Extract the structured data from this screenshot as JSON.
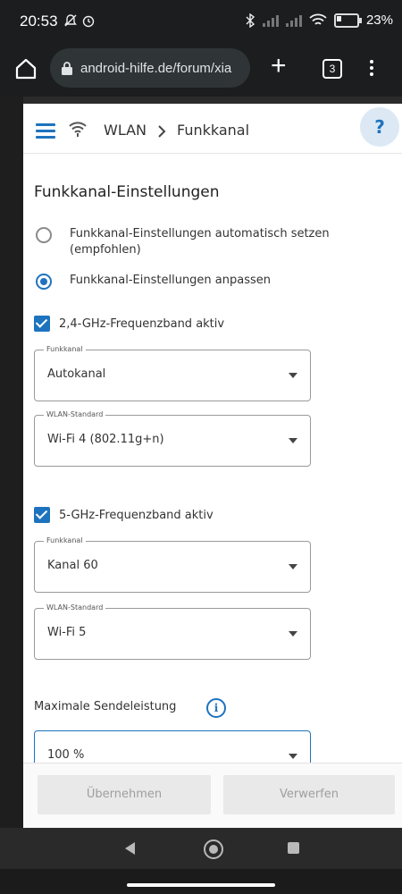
{
  "status": {
    "time": "20:53",
    "battery": "23%"
  },
  "browser": {
    "url": "android-hilfe.de/forum/xia",
    "tab_count": "3"
  },
  "app": {
    "breadcrumb": [
      "WLAN",
      "Funkkanal"
    ],
    "help_label": "?"
  },
  "page": {
    "section_title": "Funkkanal-Einstellungen",
    "radio_auto": "Funkkanal-Einstellungen automatisch setzen (empfohlen)",
    "radio_custom": "Funkkanal-Einstellungen anpassen",
    "band24": {
      "checkbox_label": "2,4-GHz-Frequenzband aktiv",
      "channel_legend": "Funkkanal",
      "channel_value": "Autokanal",
      "standard_legend": "WLAN-Standard",
      "standard_value": "Wi-Fi 4 (802.11g+n)"
    },
    "band5": {
      "checkbox_label": "5-GHz-Frequenzband aktiv",
      "channel_legend": "Funkkanal",
      "channel_value": "Kanal 60",
      "standard_legend": "WLAN-Standard",
      "standard_value": "Wi-Fi 5"
    },
    "power_label": "Maximale Sendeleistung",
    "info_symbol": "i",
    "power_value": "100 %",
    "buttons": {
      "apply": "Übernehmen",
      "discard": "Verwerfen"
    }
  },
  "colors": {
    "accent": "#1e73be",
    "disabled_bg": "#e9e9e9",
    "disabled_text": "#9e9e9e"
  },
  "icons": {
    "status": [
      "bell-off-icon",
      "alarm-icon",
      "bluetooth-icon",
      "signal-icon",
      "wifi-icon",
      "battery-icon"
    ],
    "toolbar": [
      "home-icon",
      "lock-icon",
      "plus-icon",
      "tabs-icon",
      "more-vert-icon"
    ],
    "app": [
      "hamburger-icon",
      "wifi-icon",
      "chevron-right-icon",
      "help-icon",
      "info-icon",
      "dropdown-caret-icon"
    ],
    "nav": [
      "back-icon",
      "home-icon",
      "recents-icon"
    ]
  }
}
